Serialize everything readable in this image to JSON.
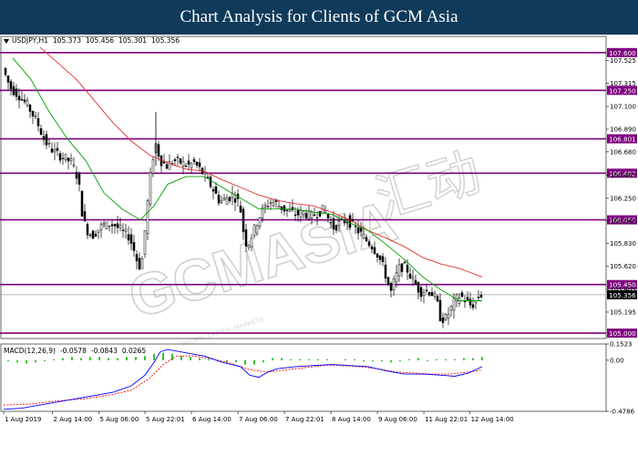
{
  "banner": {
    "title": "Chart Analysis for Clients of GCM Asia"
  },
  "symbol_info": {
    "symbol": "USDJPY,H1",
    "open": "105.373",
    "high": "105.456",
    "low": "105.301",
    "close": "105.356"
  },
  "macd_info": {
    "label": "MACD(12,26,9)",
    "main": "-0.0578",
    "signal": "-0.0843",
    "hist": "0.0265"
  },
  "watermark": {
    "text": "GCMASIA",
    "chinese": "汇动",
    "subtitle": "GLOBAL CAPITAL MARKETS"
  },
  "colors": {
    "background": "#ffffff",
    "banner": "#0f3a5a",
    "candle_up": "#000000",
    "candle_down": "#000000",
    "ma_fast": "#00a000",
    "ma_slow": "#e03030",
    "level_line": "#800080",
    "level_tag": "#800080",
    "price_tag": "#000000",
    "macd_hist": "#00b000",
    "macd_main": "#0000ff",
    "macd_signal": "#ff0000"
  },
  "chart_data": [
    {
      "type": "candlestick",
      "title": "USDJPY,H1",
      "ylim": [
        104.95,
        107.75
      ],
      "yticks": [
        {
          "value": 107.525,
          "label": "107.525"
        },
        {
          "value": 107.315,
          "label": "107.315"
        },
        {
          "value": 107.1,
          "label": "107.100"
        },
        {
          "value": 106.89,
          "label": "106.890"
        },
        {
          "value": 106.68,
          "label": "106.680"
        },
        {
          "value": 106.465,
          "label": "106.465"
        },
        {
          "value": 106.25,
          "label": "106.250"
        },
        {
          "value": 106.04,
          "label": "106.040"
        },
        {
          "value": 105.83,
          "label": "105.830"
        },
        {
          "value": 105.62,
          "label": "105.620"
        },
        {
          "value": 105.405,
          "label": "105.405"
        },
        {
          "value": 105.195,
          "label": "105.195"
        }
      ],
      "xticks": [
        {
          "label": "1 Aug 2019",
          "pos": 0.0
        },
        {
          "label": "2 Aug 14:00",
          "pos": 0.106
        },
        {
          "label": "5 Aug 06:00",
          "pos": 0.207
        },
        {
          "label": "5 Aug 22:01",
          "pos": 0.307
        },
        {
          "label": "6 Aug 14:00",
          "pos": 0.408
        },
        {
          "label": "7 Aug 06:00",
          "pos": 0.509
        },
        {
          "label": "7 Aug 22:01",
          "pos": 0.61
        },
        {
          "label": "8 Aug 14:00",
          "pos": 0.711
        },
        {
          "label": "9 Aug 06:00",
          "pos": 0.812
        },
        {
          "label": "11 Aug 22:01",
          "pos": 0.913
        },
        {
          "label": "12 Aug 14:00",
          "pos": 1.013
        }
      ],
      "levels": [
        107.6,
        107.25,
        106.801,
        106.482,
        106.05,
        105.45,
        105.0
      ],
      "level_labels": [
        "107.600",
        "107.250",
        "106.801",
        "106.482",
        "106.050",
        "105.450",
        "105.000"
      ],
      "current_price": 105.356,
      "current_price_label": "105.356",
      "price_path": [
        [
          0,
          107.5
        ],
        [
          10,
          107.28
        ],
        [
          20,
          107.2
        ],
        [
          30,
          107.1
        ],
        [
          40,
          106.95
        ],
        [
          48,
          106.78
        ],
        [
          58,
          106.68
        ],
        [
          70,
          106.62
        ],
        [
          78,
          106.58
        ],
        [
          85,
          106.42
        ],
        [
          90,
          106.05
        ],
        [
          95,
          105.95
        ],
        [
          100,
          105.9
        ],
        [
          108,
          105.97
        ],
        [
          115,
          106.02
        ],
        [
          125,
          106.0
        ],
        [
          132,
          105.95
        ],
        [
          140,
          105.9
        ],
        [
          145,
          105.8
        ],
        [
          150,
          105.65
        ],
        [
          154,
          105.6
        ],
        [
          158,
          105.95
        ],
        [
          162,
          106.3
        ],
        [
          166,
          106.6
        ],
        [
          170,
          106.75
        ],
        [
          175,
          106.6
        ],
        [
          182,
          106.55
        ],
        [
          190,
          106.6
        ],
        [
          198,
          106.58
        ],
        [
          205,
          106.55
        ],
        [
          212,
          106.58
        ],
        [
          220,
          106.5
        ],
        [
          228,
          106.4
        ],
        [
          235,
          106.3
        ],
        [
          240,
          106.22
        ],
        [
          248,
          106.25
        ],
        [
          255,
          106.28
        ],
        [
          262,
          106.2
        ],
        [
          266,
          105.95
        ],
        [
          270,
          105.8
        ],
        [
          275,
          105.9
        ],
        [
          282,
          106.05
        ],
        [
          288,
          106.15
        ],
        [
          295,
          106.22
        ],
        [
          302,
          106.2
        ],
        [
          310,
          106.15
        ],
        [
          318,
          106.12
        ],
        [
          325,
          106.1
        ],
        [
          332,
          106.12
        ],
        [
          340,
          106.08
        ],
        [
          348,
          106.12
        ],
        [
          355,
          106.15
        ],
        [
          360,
          106.05
        ],
        [
          365,
          105.98
        ],
        [
          372,
          106.02
        ],
        [
          380,
          106.05
        ],
        [
          388,
          105.98
        ],
        [
          395,
          105.92
        ],
        [
          402,
          105.85
        ],
        [
          408,
          105.8
        ],
        [
          414,
          105.72
        ],
        [
          420,
          105.6
        ],
        [
          425,
          105.45
        ],
        [
          428,
          105.38
        ],
        [
          432,
          105.5
        ],
        [
          438,
          105.62
        ],
        [
          445,
          105.6
        ],
        [
          450,
          105.52
        ],
        [
          455,
          105.45
        ],
        [
          460,
          105.38
        ],
        [
          466,
          105.4
        ],
        [
          472,
          105.38
        ],
        [
          478,
          105.3
        ],
        [
          482,
          105.15
        ],
        [
          487,
          105.12
        ],
        [
          492,
          105.2
        ],
        [
          498,
          105.3
        ],
        [
          504,
          105.35
        ],
        [
          510,
          105.3
        ],
        [
          516,
          105.25
        ],
        [
          520,
          105.28
        ],
        [
          525,
          105.356
        ]
      ],
      "ma_fast": [
        [
          10,
          107.55
        ],
        [
          30,
          107.35
        ],
        [
          50,
          107.05
        ],
        [
          70,
          106.8
        ],
        [
          90,
          106.6
        ],
        [
          110,
          106.3
        ],
        [
          130,
          106.15
        ],
        [
          150,
          106.05
        ],
        [
          165,
          106.18
        ],
        [
          180,
          106.38
        ],
        [
          200,
          106.45
        ],
        [
          220,
          106.45
        ],
        [
          240,
          106.35
        ],
        [
          260,
          106.25
        ],
        [
          280,
          106.15
        ],
        [
          300,
          106.15
        ],
        [
          320,
          106.15
        ],
        [
          340,
          106.12
        ],
        [
          360,
          106.1
        ],
        [
          380,
          106.02
        ],
        [
          400,
          105.95
        ],
        [
          420,
          105.82
        ],
        [
          440,
          105.68
        ],
        [
          460,
          105.52
        ],
        [
          480,
          105.4
        ],
        [
          500,
          105.3
        ],
        [
          525,
          105.3
        ]
      ],
      "ma_slow": [
        [
          40,
          107.65
        ],
        [
          60,
          107.5
        ],
        [
          80,
          107.35
        ],
        [
          100,
          107.15
        ],
        [
          120,
          106.95
        ],
        [
          140,
          106.78
        ],
        [
          160,
          106.65
        ],
        [
          180,
          106.58
        ],
        [
          200,
          106.52
        ],
        [
          220,
          106.5
        ],
        [
          240,
          106.42
        ],
        [
          260,
          106.35
        ],
        [
          280,
          106.28
        ],
        [
          300,
          106.23
        ],
        [
          320,
          106.2
        ],
        [
          340,
          106.18
        ],
        [
          360,
          106.12
        ],
        [
          380,
          106.05
        ],
        [
          400,
          105.95
        ],
        [
          420,
          105.88
        ],
        [
          440,
          105.8
        ],
        [
          460,
          105.7
        ],
        [
          480,
          105.64
        ],
        [
          500,
          105.6
        ],
        [
          525,
          105.52
        ]
      ]
    },
    {
      "type": "macd",
      "title": "MACD(12,26,9)",
      "ylim": [
        -0.4786,
        0.1523
      ],
      "yticks": [
        {
          "value": 0.1523,
          "label": "0.1523"
        },
        {
          "value": 0.0,
          "label": "0.00"
        },
        {
          "value": -0.4786,
          "label": "-0.4786"
        }
      ],
      "main": [
        [
          0,
          -0.46
        ],
        [
          20,
          -0.45
        ],
        [
          40,
          -0.42
        ],
        [
          60,
          -0.39
        ],
        [
          80,
          -0.36
        ],
        [
          100,
          -0.33
        ],
        [
          120,
          -0.3
        ],
        [
          140,
          -0.24
        ],
        [
          155,
          -0.14
        ],
        [
          165,
          -0.02
        ],
        [
          172,
          0.08
        ],
        [
          180,
          0.1
        ],
        [
          200,
          0.07
        ],
        [
          220,
          0.04
        ],
        [
          240,
          -0.02
        ],
        [
          260,
          -0.06
        ],
        [
          270,
          -0.14
        ],
        [
          280,
          -0.16
        ],
        [
          290,
          -0.11
        ],
        [
          300,
          -0.08
        ],
        [
          320,
          -0.06
        ],
        [
          340,
          -0.05
        ],
        [
          360,
          -0.04
        ],
        [
          380,
          -0.05
        ],
        [
          400,
          -0.06
        ],
        [
          420,
          -0.1
        ],
        [
          440,
          -0.13
        ],
        [
          460,
          -0.13
        ],
        [
          480,
          -0.14
        ],
        [
          495,
          -0.15
        ],
        [
          510,
          -0.12
        ],
        [
          525,
          -0.06
        ]
      ],
      "signal": [
        [
          0,
          -0.42
        ],
        [
          30,
          -0.41
        ],
        [
          60,
          -0.38
        ],
        [
          90,
          -0.36
        ],
        [
          120,
          -0.32
        ],
        [
          140,
          -0.28
        ],
        [
          160,
          -0.17
        ],
        [
          175,
          -0.04
        ],
        [
          190,
          0.04
        ],
        [
          210,
          0.04
        ],
        [
          230,
          0.01
        ],
        [
          250,
          -0.03
        ],
        [
          270,
          -0.09
        ],
        [
          290,
          -0.11
        ],
        [
          310,
          -0.09
        ],
        [
          330,
          -0.07
        ],
        [
          350,
          -0.05
        ],
        [
          370,
          -0.05
        ],
        [
          390,
          -0.06
        ],
        [
          410,
          -0.08
        ],
        [
          430,
          -0.11
        ],
        [
          450,
          -0.12
        ],
        [
          470,
          -0.13
        ],
        [
          490,
          -0.13
        ],
        [
          510,
          -0.11
        ],
        [
          525,
          -0.09
        ]
      ],
      "hist": [
        [
          5,
          -0.01
        ],
        [
          15,
          -0.02
        ],
        [
          25,
          -0.03
        ],
        [
          35,
          -0.02
        ],
        [
          45,
          -0.01
        ],
        [
          55,
          0.01
        ],
        [
          65,
          0.02
        ],
        [
          75,
          0.03
        ],
        [
          85,
          0.02
        ],
        [
          95,
          0.03
        ],
        [
          105,
          0.03
        ],
        [
          115,
          0.02
        ],
        [
          125,
          0.02
        ],
        [
          135,
          0.03
        ],
        [
          145,
          0.03
        ],
        [
          155,
          0.04
        ],
        [
          165,
          0.06
        ],
        [
          175,
          0.07
        ],
        [
          185,
          0.06
        ],
        [
          195,
          0.04
        ],
        [
          205,
          0.03
        ],
        [
          215,
          0.02
        ],
        [
          225,
          0.01
        ],
        [
          235,
          -0.01
        ],
        [
          245,
          -0.02
        ],
        [
          255,
          -0.02
        ],
        [
          265,
          -0.04
        ],
        [
          275,
          -0.04
        ],
        [
          285,
          -0.02
        ],
        [
          295,
          0.02
        ],
        [
          305,
          0.02
        ],
        [
          315,
          0.01
        ],
        [
          325,
          0.01
        ],
        [
          335,
          0.01
        ],
        [
          345,
          0.01
        ],
        [
          355,
          0.01
        ],
        [
          365,
          0.0
        ],
        [
          375,
          0.01
        ],
        [
          385,
          0.01
        ],
        [
          395,
          -0.01
        ],
        [
          405,
          -0.01
        ],
        [
          415,
          -0.01
        ],
        [
          425,
          -0.02
        ],
        [
          435,
          -0.01
        ],
        [
          445,
          0.01
        ],
        [
          455,
          0.02
        ],
        [
          465,
          -0.01
        ],
        [
          475,
          0.01
        ],
        [
          485,
          0.01
        ],
        [
          495,
          0.01
        ],
        [
          505,
          0.02
        ],
        [
          515,
          0.02
        ],
        [
          525,
          0.03
        ]
      ]
    }
  ]
}
